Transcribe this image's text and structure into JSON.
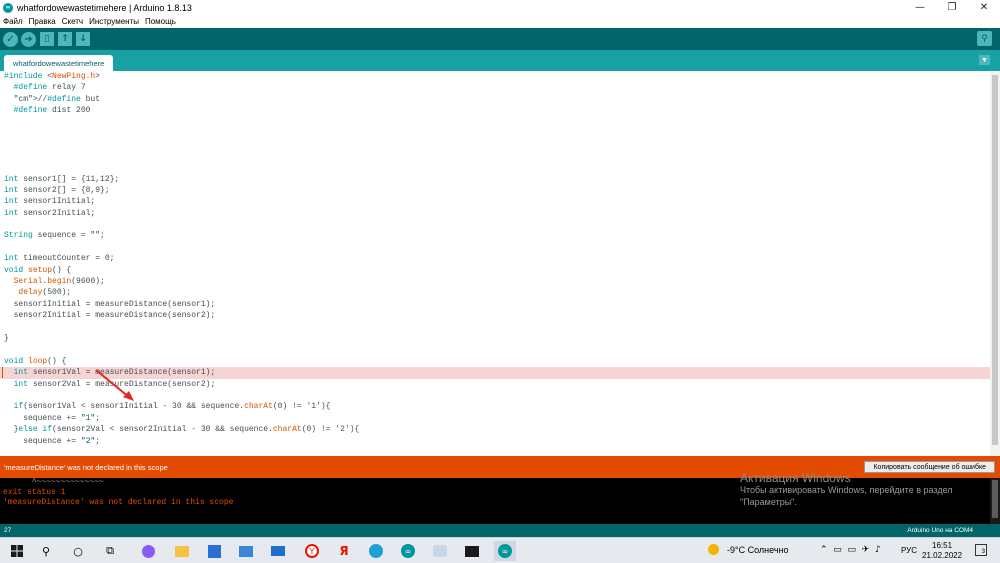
{
  "window": {
    "title": "whatfordowewastetimehere | Arduino 1.8.13",
    "minimize": "—",
    "maximize": "❐",
    "close": "✕"
  },
  "menu": [
    "Файл",
    "Правка",
    "Скетч",
    "Инструменты",
    "Помощь"
  ],
  "toolbar": {
    "verify_icon": "check-icon",
    "upload_icon": "arrow-right-icon",
    "new_icon": "document-icon",
    "open_icon": "arrow-up-icon",
    "save_icon": "arrow-down-icon",
    "serial_monitor_icon": "magnifier-icon"
  },
  "tab": {
    "label": "whatfordowewastetimehere",
    "menu_glyph": "▼"
  },
  "code": [
    "#include <NewPing.h>",
    "  #define relay 7",
    "  //#define but",
    "  #define dist 200",
    "",
    "",
    "",
    "",
    "",
    "int sensor1[] = {11,12};",
    "int sensor2[] = {8,9};",
    "int sensor1Initial;",
    "int sensor2Initial;",
    "",
    "String sequence = \"\";",
    "",
    "int timeoutCounter = 0;",
    "void setup() {",
    "  Serial.begin(9600);",
    "   delay(500);",
    "  sensor1Initial = measureDistance(sensor1);",
    "  sensor2Initial = measureDistance(sensor2);",
    "",
    "}",
    "",
    "void loop() {",
    "  int sensor1Val = measureDistance(sensor1);",
    "  int sensor2Val = measureDistance(sensor2);",
    "",
    "  if(sensor1Val < sensor1Initial - 30 && sequence.charAt(0) != '1'){",
    "    sequence += \"1\";",
    "  }else if(sensor2Val < sensor2Initial - 30 && sequence.charAt(0) != '2'){",
    "    sequence += \"2\";"
  ],
  "error_line_index": 26,
  "error_bar": {
    "message": "'measureDistance' was not declared in this scope",
    "copy_button": "Копировать сообщение об ошибке"
  },
  "console": [
    "      ^~~~~~~~~~~~~~~",
    "exit status 1",
    "'measureDistance' was not declared in this scope"
  ],
  "activation": {
    "title": "Активация Windows",
    "line1": "Чтобы активировать Windows, перейдите в раздел",
    "line2": "\"Параметры\"."
  },
  "status": {
    "line_number": "27",
    "board": "Arduino Uno на COM4"
  },
  "taskbar": {
    "weather": "-9°C  Солнечно",
    "lang": "РУС",
    "time": "16:51",
    "date": "21.02.2022",
    "notifications": "3"
  },
  "colors": {
    "teal_dark": "#006468",
    "teal_tab": "#17a1a5",
    "error_orange": "#e34c00",
    "error_line": "#f7d4d4"
  }
}
